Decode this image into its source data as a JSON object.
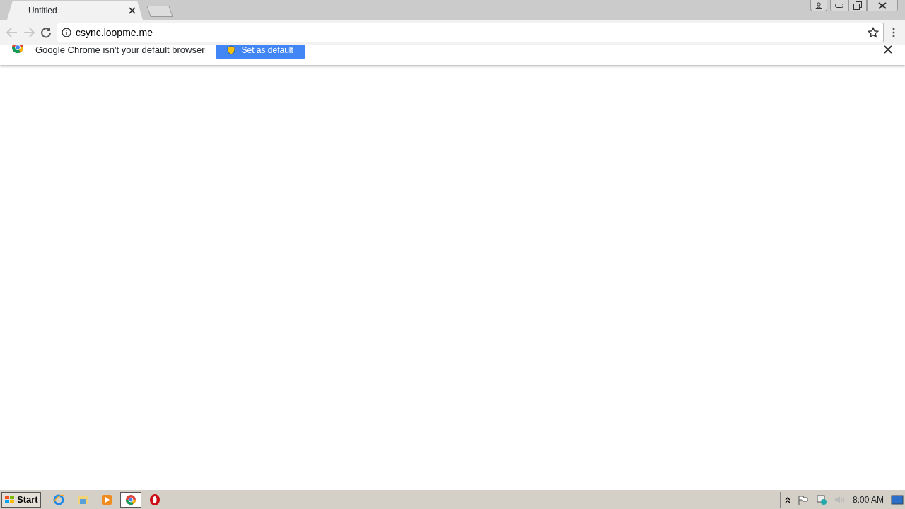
{
  "tabs": [
    {
      "label": "Untitled",
      "selected": true
    }
  ],
  "address": {
    "value": "csync.loopme.me"
  },
  "infobar": {
    "message": "Google Chrome isn't your default browser",
    "button": "Set as default"
  },
  "taskbar": {
    "start": "Start",
    "apps": [
      {
        "kind": "ie",
        "active": false
      },
      {
        "kind": "folder",
        "active": false
      },
      {
        "kind": "media",
        "active": false
      },
      {
        "kind": "chrome",
        "active": true
      },
      {
        "kind": "opera",
        "active": false
      }
    ],
    "clock": "8:00 AM"
  }
}
